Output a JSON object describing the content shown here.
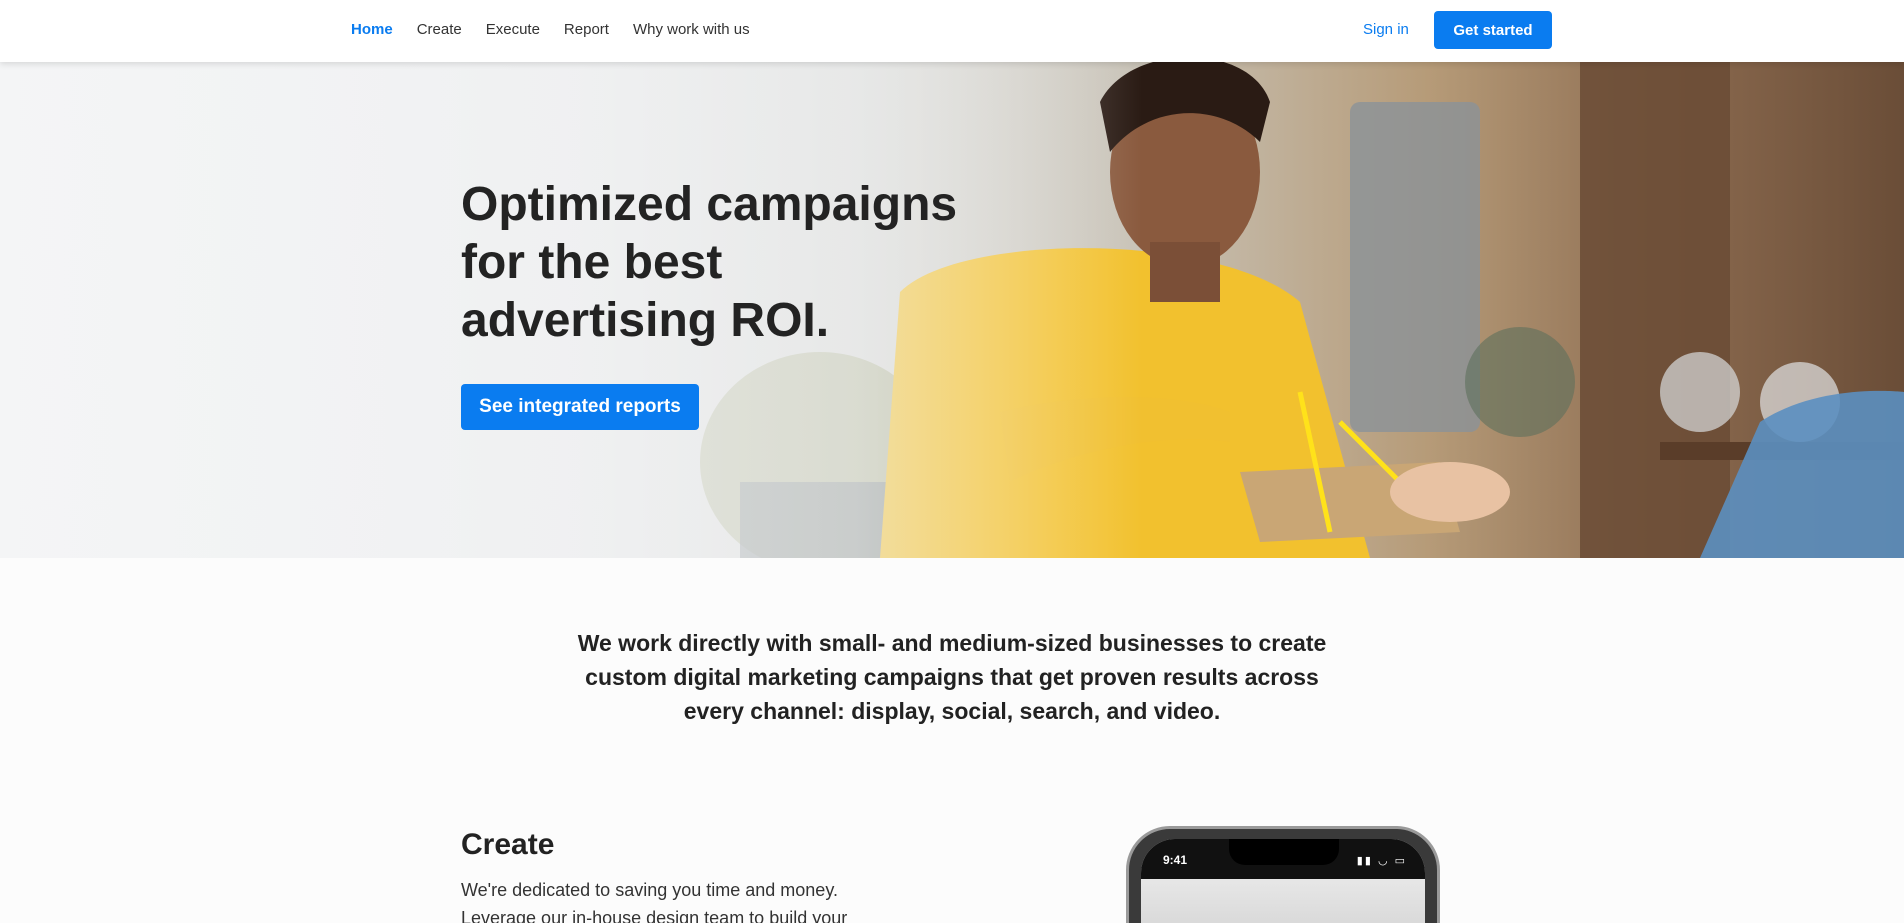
{
  "nav": {
    "links": [
      {
        "label": "Home",
        "active": true
      },
      {
        "label": "Create"
      },
      {
        "label": "Execute"
      },
      {
        "label": "Report"
      },
      {
        "label": "Why work with us"
      }
    ],
    "signin": "Sign in",
    "get_started": "Get started"
  },
  "hero": {
    "title": "Optimized campaigns for the best advertising ROI.",
    "cta": "See integrated reports"
  },
  "intro": {
    "text": "We work directly with small- and medium-sized businesses to create custom digital marketing campaigns that get proven results across every channel: display, social, search, and video."
  },
  "create": {
    "title": "Create",
    "body": "We're dedicated to saving you time and money. Leverage our in-house design team to build your"
  },
  "phone": {
    "time": "9:41"
  },
  "colors": {
    "accent": "#0a7cf0",
    "text": "#232323"
  }
}
